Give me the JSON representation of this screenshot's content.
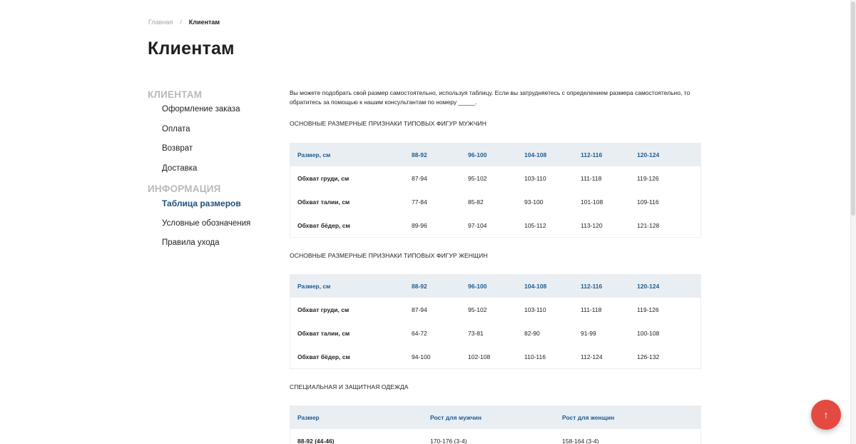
{
  "breadcrumb": {
    "home": "Главная",
    "separator": "/",
    "current": "Клиентам"
  },
  "page_title": "Клиентам",
  "sidebar": {
    "section1_title": "КЛИЕНТАМ",
    "section1_items": [
      "Оформление заказа",
      "Оплата",
      "Возврат",
      "Доставка"
    ],
    "section2_title": "ИНФОРМАЦИЯ",
    "section2_items": [
      "Таблица размеров",
      "Условные обозначения",
      "Правила ухода"
    ],
    "active_item": "Таблица размеров"
  },
  "intro_text": "Вы можете подобрать свой размер самостоятельно, используя таблицу. Если вы затрудняетесь с определением размера самостоятельно, то обратитесь за помощью к нашим консультантам по номеру _____.",
  "men_table": {
    "title": "ОСНОВНЫЕ РАЗМЕРНЫЕ ПРИЗНАКИ ТИПОВЫХ ФИГУР МУЖЧИН",
    "headers": [
      "Размер, см",
      "88-92",
      "96-100",
      "104-108",
      "112-116",
      "120-124"
    ],
    "rows": [
      [
        "Обхват груди, см",
        "87-94",
        "95-102",
        "103-110",
        "111-118",
        "119-126"
      ],
      [
        "Обхват талии, см",
        "77-84",
        "85-82",
        "93-100",
        "101-108",
        "109-116"
      ],
      [
        "Обхват бёдер, см",
        "89-96",
        "97-104",
        "105-112",
        "113-120",
        "121-128"
      ]
    ]
  },
  "women_table": {
    "title": "ОСНОВНЫЕ РАЗМЕРНЫЕ ПРИЗНАКИ ТИПОВЫХ ФИГУР ЖЕНЩИН",
    "headers": [
      "Размер, см",
      "88-92",
      "96-100",
      "104-108",
      "112-116",
      "120-124"
    ],
    "rows": [
      [
        "Обхват груди, см",
        "87-94",
        "95-102",
        "103-110",
        "111-118",
        "119-126"
      ],
      [
        "Обхват талии, см",
        "64-72",
        "73-81",
        "82-90",
        "91-99",
        "100-108"
      ],
      [
        "Обхват бёдер, см",
        "94-100",
        "102-108",
        "110-116",
        "112-124",
        "126-132"
      ]
    ]
  },
  "workwear_table": {
    "title": "СПЕЦИАЛЬНАЯ И ЗАЩИТНАЯ ОДЕЖДА",
    "headers": [
      "Размер",
      "Рост для мужчин",
      "Рост для женщин"
    ],
    "rows": [
      [
        "88-92 (44-46)",
        "170-176 (3-4)",
        "158-164 (3-4)"
      ]
    ]
  },
  "scroll_top_button": {
    "icon": "arrow-up-icon",
    "glyph": "↑",
    "color": "#e34b42"
  },
  "colors": {
    "accent": "#1f5c92",
    "header_bg": "#e9eef3",
    "muted": "#b9b9b9"
  }
}
